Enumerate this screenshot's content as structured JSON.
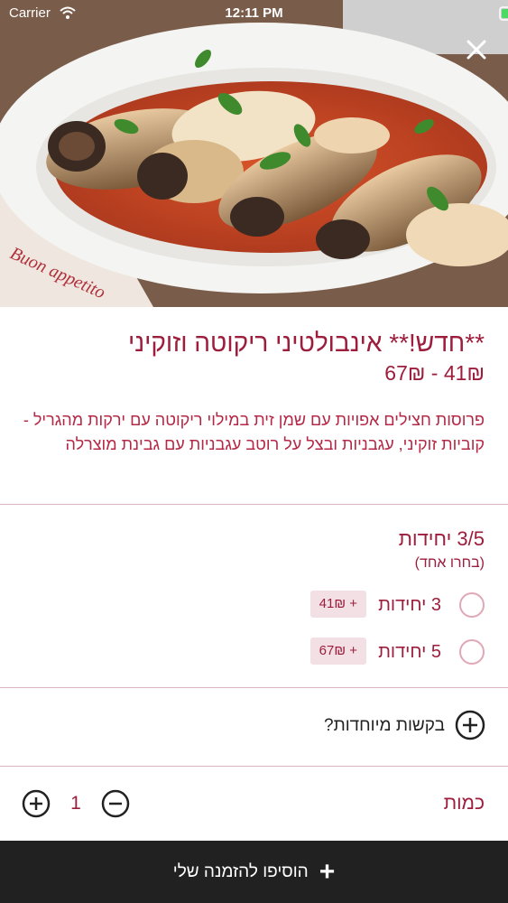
{
  "status_bar": {
    "carrier": "Carrier",
    "time": "12:11 PM"
  },
  "hero": {
    "image_text": "Buon appetito"
  },
  "item": {
    "title": "**חדש!** אינבולטיני ריקוטה וזוקיני",
    "price_range": "41₪ - 67₪",
    "description": "פרוסות חצילים אפויות עם שמן זית במילוי ריקוטה עם ירקות מהגריל - קוביות זוקיני, עגבניות ובצל על רוטב עגבניות עם גבינת מוצרלה"
  },
  "options_group": {
    "title": "3/5 יחידות",
    "hint": "(בחרו אחד)",
    "options": [
      {
        "label": "3 יחידות",
        "price": "+ 41₪"
      },
      {
        "label": "5 יחידות",
        "price": "+ 67₪"
      }
    ]
  },
  "special_requests": {
    "label": "בקשות מיוחדות?"
  },
  "quantity": {
    "label": "כמות",
    "value": "1"
  },
  "add_button": {
    "label": "הוסיפו להזמנה שלי"
  },
  "colors": {
    "accent": "#9c1e3c",
    "bar": "#212121",
    "battery": "#4cd964"
  }
}
